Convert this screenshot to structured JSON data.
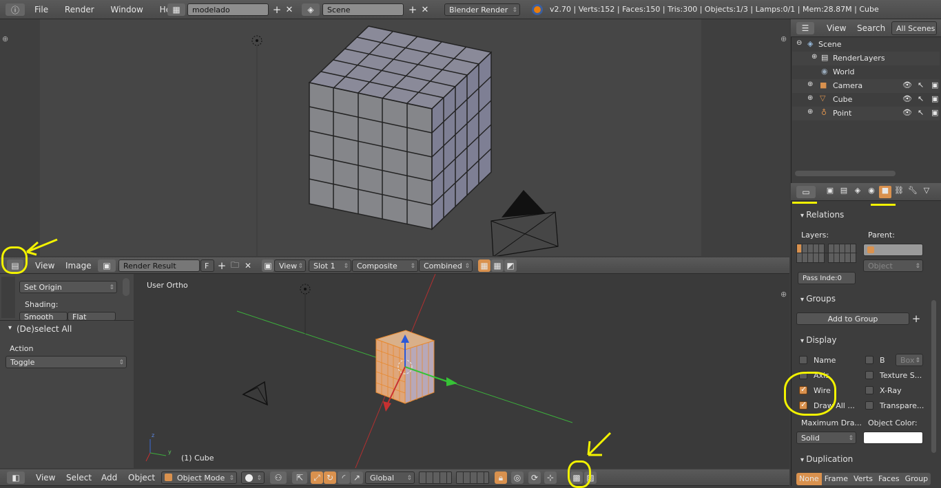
{
  "info_bar": {
    "menus": [
      "File",
      "Render",
      "Window",
      "Help"
    ],
    "screen_layout": "modelado",
    "scene": "Scene",
    "engine": "Blender Render",
    "stats": "v2.70 | Verts:152 | Faces:150 | Tris:300 | Objects:1/3 | Lamps:0/1 | Mem:28.87M | Cube"
  },
  "image_editor": {
    "menus": [
      "View",
      "Image"
    ],
    "image_name": "Render Result",
    "fake_user": "F",
    "view": "View",
    "slot": "Slot 1",
    "composite": "Composite",
    "pass": "Combined"
  },
  "tool_shelf": {
    "set_origin": "Set Origin",
    "shading_label": "Shading:",
    "smooth": "Smooth",
    "flat": "Flat",
    "operator_title": "(De)select All",
    "action_label": "Action",
    "action_value": "Toggle"
  },
  "viewport": {
    "view_name": "User Ortho",
    "object_label": "(1) Cube"
  },
  "view3d_header": {
    "menus": [
      "View",
      "Select",
      "Add",
      "Object"
    ],
    "mode": "Object Mode",
    "orientation": "Global"
  },
  "outliner": {
    "view": "View",
    "search": "Search",
    "filter": "All Scenes",
    "items": [
      {
        "name": "Scene"
      },
      {
        "name": "RenderLayers"
      },
      {
        "name": "World"
      },
      {
        "name": "Camera"
      },
      {
        "name": "Cube"
      },
      {
        "name": "Point"
      }
    ]
  },
  "properties": {
    "relations": {
      "title": "Relations",
      "layers_label": "Layers:",
      "parent_label": "Parent:",
      "parent_type": "Object",
      "pass_index": "Pass Inde:0"
    },
    "groups": {
      "title": "Groups",
      "add_button": "Add to Group"
    },
    "display": {
      "title": "Display",
      "name": "Name",
      "bounds": "B",
      "bounds_type": "Box",
      "axis": "Axis",
      "texture_space": "Texture S...",
      "wire": "Wire",
      "xray": "X-Ray",
      "draw_all": "Draw All ...",
      "transparency": "Transpare...",
      "max_draw_label": "Maximum Dra...",
      "max_draw_value": "Solid",
      "object_color_label": "Object Color:"
    },
    "duplication": {
      "title": "Duplication",
      "options": [
        "None",
        "Frame",
        "Verts",
        "Faces",
        "Group"
      ],
      "selected": "None"
    }
  },
  "colors": {
    "accent": "#d9914e",
    "highlight": "#f2f200",
    "object_color": "#ffffff"
  }
}
